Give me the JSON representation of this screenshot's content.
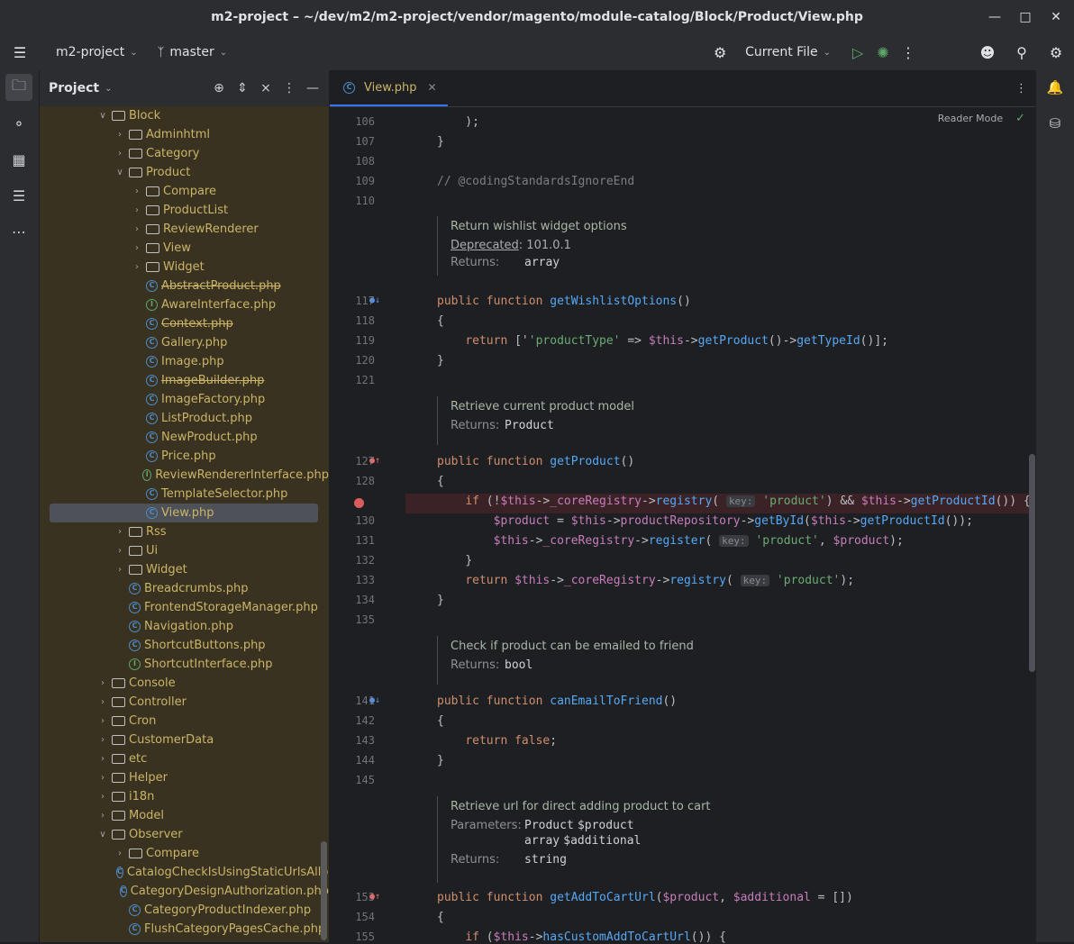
{
  "window": {
    "title": "m2-project – ~/dev/m2/m2-project/vendor/magento/module-catalog/Block/Product/View.php"
  },
  "toolbar": {
    "project": "m2-project",
    "branch": "master",
    "run_config": "Current File"
  },
  "project_panel": {
    "title": "Project"
  },
  "tree": [
    {
      "depth": 3,
      "type": "folder",
      "open": true,
      "label": "Block"
    },
    {
      "depth": 4,
      "type": "folder",
      "open": false,
      "label": "Adminhtml"
    },
    {
      "depth": 4,
      "type": "folder",
      "open": false,
      "label": "Category"
    },
    {
      "depth": 4,
      "type": "folder",
      "open": true,
      "label": "Product"
    },
    {
      "depth": 5,
      "type": "folder",
      "open": false,
      "label": "Compare"
    },
    {
      "depth": 5,
      "type": "folder",
      "open": false,
      "label": "ProductList"
    },
    {
      "depth": 5,
      "type": "folder",
      "open": false,
      "label": "ReviewRenderer"
    },
    {
      "depth": 5,
      "type": "folder",
      "open": false,
      "label": "View"
    },
    {
      "depth": 5,
      "type": "folder",
      "open": false,
      "label": "Widget"
    },
    {
      "depth": 5,
      "type": "class",
      "label": "AbstractProduct.php",
      "strike": true
    },
    {
      "depth": 5,
      "type": "interface",
      "label": "AwareInterface.php"
    },
    {
      "depth": 5,
      "type": "class",
      "label": "Context.php",
      "strike": true
    },
    {
      "depth": 5,
      "type": "class",
      "label": "Gallery.php"
    },
    {
      "depth": 5,
      "type": "class",
      "label": "Image.php"
    },
    {
      "depth": 5,
      "type": "class",
      "label": "ImageBuilder.php",
      "strike": true
    },
    {
      "depth": 5,
      "type": "class",
      "label": "ImageFactory.php"
    },
    {
      "depth": 5,
      "type": "class",
      "label": "ListProduct.php"
    },
    {
      "depth": 5,
      "type": "class",
      "label": "NewProduct.php"
    },
    {
      "depth": 5,
      "type": "class",
      "label": "Price.php"
    },
    {
      "depth": 5,
      "type": "interface",
      "label": "ReviewRendererInterface.php"
    },
    {
      "depth": 5,
      "type": "class",
      "label": "TemplateSelector.php"
    },
    {
      "depth": 5,
      "type": "class",
      "label": "View.php",
      "selected": true
    },
    {
      "depth": 4,
      "type": "folder",
      "open": false,
      "label": "Rss"
    },
    {
      "depth": 4,
      "type": "folder",
      "open": false,
      "label": "Ui"
    },
    {
      "depth": 4,
      "type": "folder",
      "open": false,
      "label": "Widget"
    },
    {
      "depth": 4,
      "type": "class",
      "label": "Breadcrumbs.php"
    },
    {
      "depth": 4,
      "type": "class",
      "label": "FrontendStorageManager.php"
    },
    {
      "depth": 4,
      "type": "class",
      "label": "Navigation.php"
    },
    {
      "depth": 4,
      "type": "class",
      "label": "ShortcutButtons.php"
    },
    {
      "depth": 4,
      "type": "interface",
      "label": "ShortcutInterface.php"
    },
    {
      "depth": 3,
      "type": "folder",
      "open": false,
      "label": "Console"
    },
    {
      "depth": 3,
      "type": "folder",
      "open": false,
      "label": "Controller"
    },
    {
      "depth": 3,
      "type": "folder",
      "open": false,
      "label": "Cron"
    },
    {
      "depth": 3,
      "type": "folder",
      "open": false,
      "label": "CustomerData"
    },
    {
      "depth": 3,
      "type": "folder",
      "open": false,
      "label": "etc"
    },
    {
      "depth": 3,
      "type": "folder",
      "open": false,
      "label": "Helper"
    },
    {
      "depth": 3,
      "type": "folder",
      "open": false,
      "label": "i18n"
    },
    {
      "depth": 3,
      "type": "folder",
      "open": false,
      "label": "Model"
    },
    {
      "depth": 3,
      "type": "folder",
      "open": true,
      "label": "Observer"
    },
    {
      "depth": 4,
      "type": "folder",
      "open": false,
      "label": "Compare"
    },
    {
      "depth": 4,
      "type": "class",
      "label": "CatalogCheckIsUsingStaticUrlsAllowedObserver.php"
    },
    {
      "depth": 4,
      "type": "class",
      "label": "CategoryDesignAuthorization.php"
    },
    {
      "depth": 4,
      "type": "class",
      "label": "CategoryProductIndexer.php"
    },
    {
      "depth": 4,
      "type": "class",
      "label": "FlushCategoryPagesCache.php"
    }
  ],
  "editor": {
    "tab": "View.php",
    "reader_mode": "Reader Mode",
    "docs": {
      "d1": {
        "title": "Return wishlist widget options",
        "deprecated_label": "Deprecated",
        "deprecated_value": ": 101.0.1",
        "returns_label": "Returns:",
        "returns_value": "array"
      },
      "d2": {
        "title": "Retrieve current product model",
        "returns_label": "Returns:",
        "returns_value": "Product"
      },
      "d3": {
        "title": "Check if product can be emailed to friend",
        "returns_label": "Returns:",
        "returns_value": "bool"
      },
      "d4": {
        "title": "Retrieve url for direct adding product to cart",
        "params_label": "Parameters:",
        "param1_type": "Product",
        "param1_name": "$product",
        "param2_type": "array",
        "param2_name": "$additional",
        "returns_label": "Returns:",
        "returns_value": "string"
      }
    },
    "line_numbers": {
      "l106": "106",
      "l107": "107",
      "l108": "108",
      "l109": "109",
      "l110": "110",
      "l117": "117",
      "l118": "118",
      "l119": "119",
      "l120": "120",
      "l121": "121",
      "l127": "127",
      "l128": "128",
      "l129": "129",
      "l130": "130",
      "l131": "131",
      "l132": "132",
      "l133": "133",
      "l134": "134",
      "l135": "135",
      "l141": "141",
      "l142": "142",
      "l143": "143",
      "l144": "144",
      "l145": "145",
      "l153": "153",
      "l154": "154",
      "l155": "155"
    },
    "hints": {
      "key": "key:"
    },
    "code": {
      "c106": "    );",
      "c107": "}",
      "c109": "// @codingStandardsIgnoreEnd",
      "pub": "public",
      "function": "function",
      "fn117": "getWishlistOptions",
      "paren": "()",
      "brace_open": "{",
      "brace_close": "}",
      "ret": "return",
      "c119_a": " ['",
      "c119_str": "'productType'",
      "c119_b": " => ",
      "this": "$this",
      "arrow": "->",
      "getProduct": "getProduct",
      "getTypeId": "getTypeId",
      "c119_end": "()];",
      "fn127": "getProduct",
      "if": "if",
      "c129_a": " (!",
      "coreReg": "_coreRegistry",
      "registry": "registry",
      "c129_str": "'product'",
      "c129_b": ") && ",
      "getProductId": "getProductId",
      "c129_end": "()) {",
      "product_var": "$product",
      "eq": " = ",
      "productRepository": "productRepository",
      "getById": "getById",
      "c130_end": "());",
      "register": "register",
      "c131_str": "'product'",
      "c131_end": ");",
      "c133_end": ");",
      "fn141": "canEmailToFriend",
      "false": "false",
      "semi": ";",
      "fn153": "getAddToCartUrl",
      "additional_var": "$additional",
      "c153_end": " = [])",
      "hasCustom": "hasCustomAddToCartUrl",
      "c155_end": "()) {"
    }
  }
}
